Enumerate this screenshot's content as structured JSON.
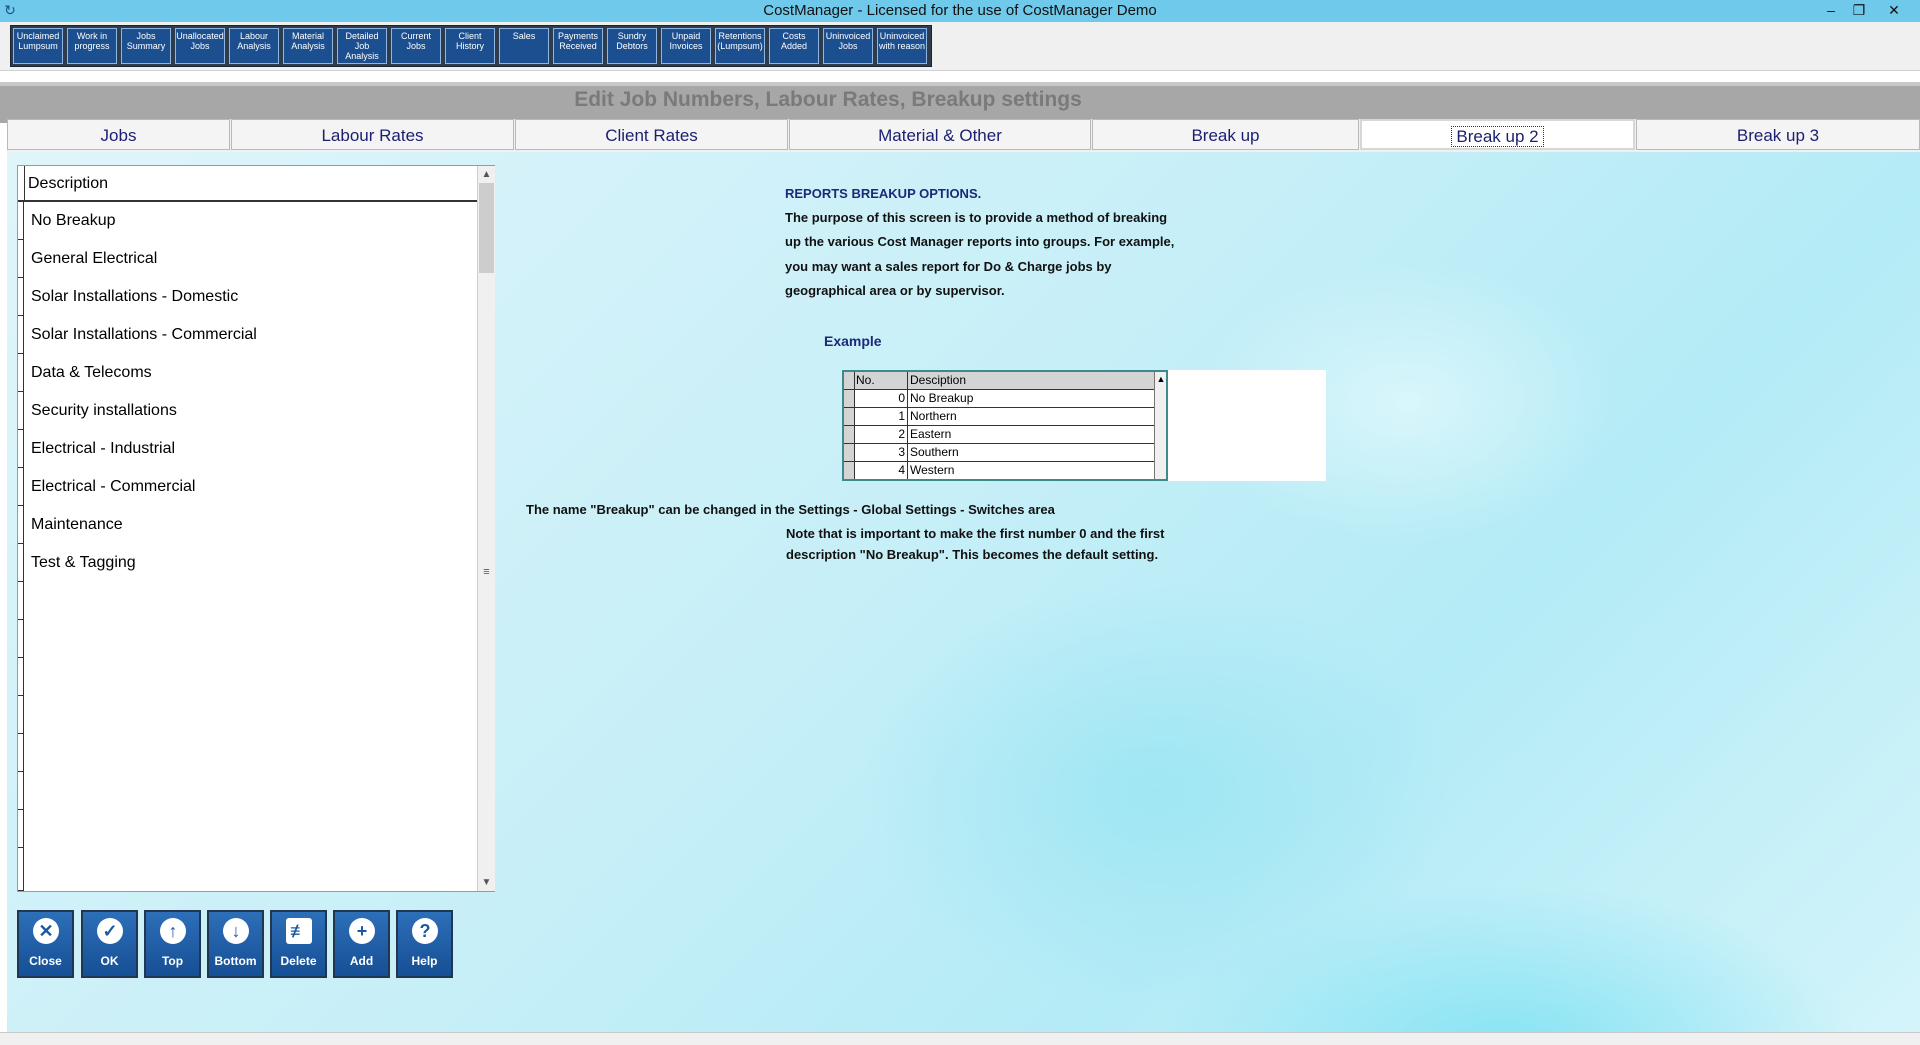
{
  "window": {
    "title": "CostManager - Licensed for the use of CostManager Demo",
    "controls": [
      "minimize-icon",
      "restore-icon",
      "close-icon"
    ]
  },
  "toolbar": [
    {
      "label": "Unclaimed Lumpsum"
    },
    {
      "label": "Work in progress"
    },
    {
      "label": "Jobs Summary"
    },
    {
      "label": "Unallocated Jobs"
    },
    {
      "label": "Labour Analysis"
    },
    {
      "label": "Material Analysis"
    },
    {
      "label": "Detailed Job Analysis"
    },
    {
      "label": "Current Jobs"
    },
    {
      "label": "Client History"
    },
    {
      "label": "Sales"
    },
    {
      "label": "Payments Received"
    },
    {
      "label": "Sundry Debtors"
    },
    {
      "label": "Unpaid Invoices"
    },
    {
      "label": "Retentions (Lumpsum)"
    },
    {
      "label": "Costs Added"
    },
    {
      "label": "Uninvoiced Jobs"
    },
    {
      "label": "Uninvoiced with reason"
    }
  ],
  "header": {
    "title": "Edit Job Numbers,  Labour Rates,  Breakup settings"
  },
  "tabs": [
    {
      "label": "Jobs"
    },
    {
      "label": "Labour Rates"
    },
    {
      "label": "Client Rates"
    },
    {
      "label": "Material & Other"
    },
    {
      "label": "Break up"
    },
    {
      "label": "Break up 2",
      "active": true
    },
    {
      "label": "Break up 3"
    }
  ],
  "grid": {
    "column": "Description",
    "rows": [
      "No Breakup",
      "General Electrical",
      "Solar Installations - Domestic",
      "Solar Installations - Commercial",
      "Data & Telecoms",
      "Security installations",
      "Electrical - Industrial",
      "Electrical - Commercial",
      "Maintenance",
      "Test & Tagging"
    ]
  },
  "buttons": [
    {
      "label": "Close",
      "icon": "close-icon"
    },
    {
      "label": "OK",
      "icon": "check-icon"
    },
    {
      "label": "Top",
      "icon": "arrow-up-icon"
    },
    {
      "label": "Bottom",
      "icon": "arrow-down-icon"
    },
    {
      "label": "Delete",
      "icon": "trash-icon"
    },
    {
      "label": "Add",
      "icon": "plus-icon"
    },
    {
      "label": "Help",
      "icon": "question-icon"
    }
  ],
  "info": {
    "heading": "REPORTS BREAKUP OPTIONS.",
    "lines": [
      "The purpose of this screen is to provide a method of breaking",
      "up the various Cost Manager reports into groups.  For example,",
      "you may want a sales report for Do & Charge jobs by",
      "geographical area or by supervisor."
    ],
    "example_label": "Example",
    "name_note": "The name \"Breakup\"  can be changed in the Settings - Global Settings - Switches area",
    "note_lines": [
      "Note that is important to make the first number 0 and the first",
      "description \"No Breakup\".  This becomes the default setting."
    ]
  },
  "example_table": {
    "headers": [
      "No.",
      "Desciption"
    ],
    "rows": [
      {
        "no": "0",
        "desc": "No Breakup"
      },
      {
        "no": "1",
        "desc": "Northern"
      },
      {
        "no": "2",
        "desc": "Eastern"
      },
      {
        "no": "3",
        "desc": "Southern"
      },
      {
        "no": "4",
        "desc": "Western"
      }
    ]
  },
  "colors": {
    "titlebar": "#6fc9ea",
    "toolbar_button": "#1c4f8f",
    "tab_text": "#1a1f70",
    "info_heading": "#1a2a78"
  }
}
